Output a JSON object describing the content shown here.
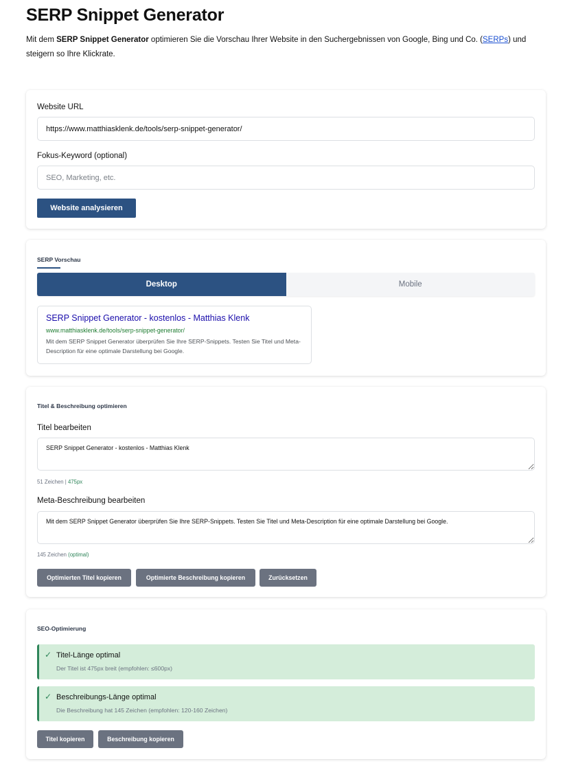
{
  "header": {
    "title": "SERP Snippet Generator",
    "intro_before": "Mit dem ",
    "intro_bold": "SERP Snippet Generator",
    "intro_middle": " optimieren Sie die Vorschau Ihrer Website in den Suchergebnissen von Google, Bing und Co. (",
    "intro_link": "SERPs",
    "intro_after": ") und steigern so Ihre Klickrate."
  },
  "analyze": {
    "url_label": "Website URL",
    "url_value": "https://www.matthiasklenk.de/tools/serp-snippet-generator/",
    "keyword_label": "Fokus-Keyword (optional)",
    "keyword_placeholder": "SEO, Marketing, etc.",
    "analyze_button": "Website analysieren"
  },
  "preview": {
    "heading": "SERP Vorschau",
    "tabs": [
      {
        "label": "Desktop",
        "active": true
      },
      {
        "label": "Mobile",
        "active": false
      }
    ],
    "snippet": {
      "title": "SERP Snippet Generator - kostenlos - Matthias Klenk",
      "url": "www.matthiasklenk.de/tools/serp-snippet-generator/",
      "description": "Mit dem SERP Snippet Generator überprüfen Sie Ihre SERP-Snippets. Testen Sie Titel und Meta-Description für eine optimale Darstellung bei Google."
    }
  },
  "optimize": {
    "heading": "Titel & Beschreibung optimieren",
    "title_label": "Titel bearbeiten",
    "title_value": "SERP Snippet Generator - kostenlos - Matthias Klenk",
    "title_chars": "51 Zeichen",
    "title_sep": " | ",
    "title_px": "475px",
    "desc_label": "Meta-Beschreibung bearbeiten",
    "desc_value": "Mit dem SERP Snippet Generator überprüfen Sie Ihre SERP-Snippets. Testen Sie Titel und Meta-Description für eine optimale Darstellung bei Google.",
    "desc_chars": "145 Zeichen ",
    "desc_status": "(optimal)",
    "copy_title_button": "Optimierten Titel kopieren",
    "copy_desc_button": "Optimierte Beschreibung kopieren",
    "reset_button": "Zurücksetzen"
  },
  "seo": {
    "heading": "SEO-Optimierung",
    "results": [
      {
        "title": "Titel-Länge optimal",
        "desc": "Der Titel ist 475px breit (empfohlen: ≤600px)"
      },
      {
        "title": "Beschreibungs-Länge optimal",
        "desc": "Die Beschreibung hat 145 Zeichen (empfohlen: 120-160 Zeichen)"
      }
    ],
    "check_glyph": "✓",
    "copy_title_button": "Titel kopieren",
    "copy_desc_button": "Beschreibung kopieren"
  },
  "colors": {
    "primary": "#2c5282",
    "success_bg": "#d4edda",
    "success_text": "#2f855a",
    "serp_title": "#1a0dab",
    "serp_url": "#1e7c31",
    "gray_button": "#6b7280"
  }
}
